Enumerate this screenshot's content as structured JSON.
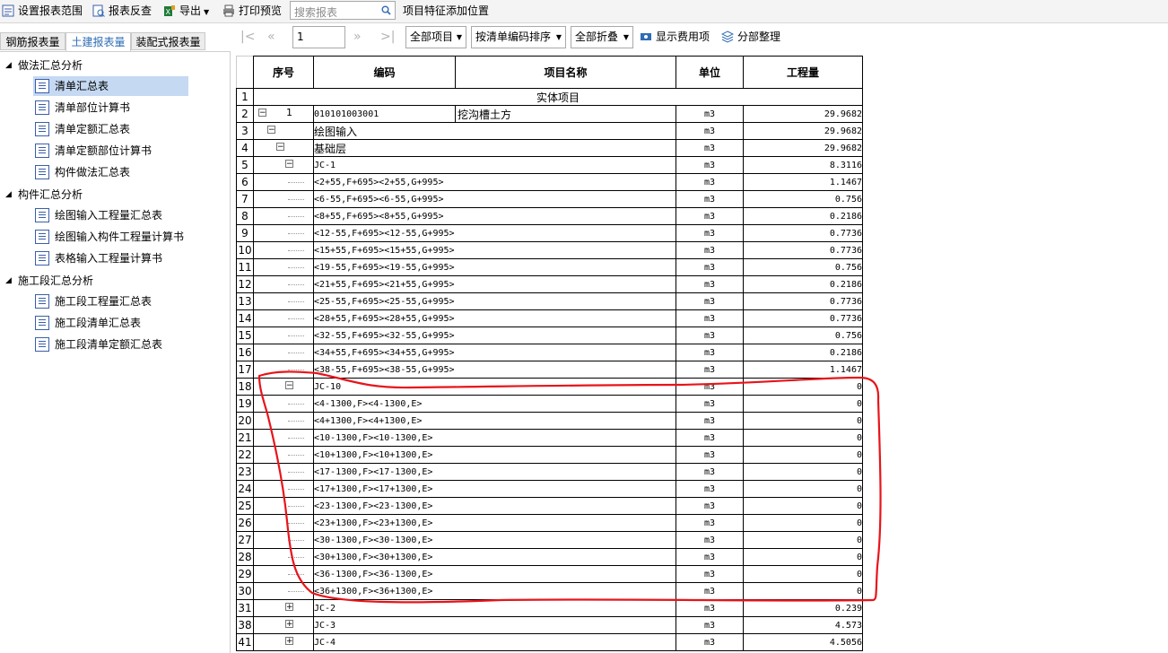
{
  "toolbar": {
    "items": [
      {
        "label": "设置报表范围",
        "icon": "report-range-icon"
      },
      {
        "label": "报表反查",
        "icon": "report-lookup-icon"
      },
      {
        "label": "导出",
        "icon": "export-icon"
      },
      {
        "label": "打印预览",
        "icon": "print-preview-icon"
      }
    ],
    "search_placeholder": "搜索报表",
    "feature_position": "项目特征添加位置"
  },
  "tabs": [
    {
      "label": "钢筋报表量",
      "active": false
    },
    {
      "label": "土建报表量",
      "active": true
    },
    {
      "label": "装配式报表量",
      "active": false
    }
  ],
  "tree": [
    {
      "group": "做法汇总分析",
      "items": [
        "清单汇总表",
        "清单部位计算书",
        "清单定额汇总表",
        "清单定额部位计算书",
        "构件做法汇总表"
      ]
    },
    {
      "group": "构件汇总分析",
      "items": [
        "绘图输入工程量汇总表",
        "绘图输入构件工程量计算书",
        "表格输入工程量计算书"
      ]
    },
    {
      "group": "施工段汇总分析",
      "items": [
        "施工段工程量汇总表",
        "施工段清单汇总表",
        "施工段清单定额汇总表"
      ]
    }
  ],
  "selected_item": "清单汇总表",
  "pager": {
    "page": "1"
  },
  "filters": {
    "scope": "全部项目",
    "sort": "按清单编码排序",
    "fold": "全部折叠",
    "show_cost": "显示费用项",
    "reorganize": "分部整理"
  },
  "table": {
    "headers": [
      "序号",
      "编码",
      "项目名称",
      "单位",
      "工程量"
    ],
    "section_title": "实体项目",
    "rows": [
      {
        "n": "1",
        "seq": "",
        "code": "",
        "name": "",
        "unit": "",
        "qty": ""
      },
      {
        "n": "2",
        "seq": "1",
        "code": "010101003001",
        "name": "挖沟槽土方",
        "unit": "m3",
        "qty": "29.9682"
      },
      {
        "n": "3",
        "seq": "",
        "code": "绘图输入",
        "name": "",
        "unit": "m3",
        "qty": "29.9682"
      },
      {
        "n": "4",
        "seq": "",
        "code": "基础层",
        "name": "",
        "unit": "m3",
        "qty": "29.9682"
      },
      {
        "n": "5",
        "seq": "",
        "code": "JC-1",
        "name": "",
        "unit": "m3",
        "qty": "8.3116"
      },
      {
        "n": "6",
        "seq": "",
        "code": "<2+55,F+695><2+55,G+995>",
        "name": "",
        "unit": "m3",
        "qty": "1.1467"
      },
      {
        "n": "7",
        "seq": "",
        "code": "<6-55,F+695><6-55,G+995>",
        "name": "",
        "unit": "m3",
        "qty": "0.756"
      },
      {
        "n": "8",
        "seq": "",
        "code": "<8+55,F+695><8+55,G+995>",
        "name": "",
        "unit": "m3",
        "qty": "0.2186"
      },
      {
        "n": "9",
        "seq": "",
        "code": "<12-55,F+695><12-55,G+995>",
        "name": "",
        "unit": "m3",
        "qty": "0.7736"
      },
      {
        "n": "10",
        "seq": "",
        "code": "<15+55,F+695><15+55,G+995>",
        "name": "",
        "unit": "m3",
        "qty": "0.7736"
      },
      {
        "n": "11",
        "seq": "",
        "code": "<19-55,F+695><19-55,G+995>",
        "name": "",
        "unit": "m3",
        "qty": "0.756"
      },
      {
        "n": "12",
        "seq": "",
        "code": "<21+55,F+695><21+55,G+995>",
        "name": "",
        "unit": "m3",
        "qty": "0.2186"
      },
      {
        "n": "13",
        "seq": "",
        "code": "<25-55,F+695><25-55,G+995>",
        "name": "",
        "unit": "m3",
        "qty": "0.7736"
      },
      {
        "n": "14",
        "seq": "",
        "code": "<28+55,F+695><28+55,G+995>",
        "name": "",
        "unit": "m3",
        "qty": "0.7736"
      },
      {
        "n": "15",
        "seq": "",
        "code": "<32-55,F+695><32-55,G+995>",
        "name": "",
        "unit": "m3",
        "qty": "0.756"
      },
      {
        "n": "16",
        "seq": "",
        "code": "<34+55,F+695><34+55,G+995>",
        "name": "",
        "unit": "m3",
        "qty": "0.2186"
      },
      {
        "n": "17",
        "seq": "",
        "code": "<38-55,F+695><38-55,G+995>",
        "name": "",
        "unit": "m3",
        "qty": "1.1467"
      },
      {
        "n": "18",
        "seq": "",
        "code": "JC-10",
        "name": "",
        "unit": "m3",
        "qty": "0"
      },
      {
        "n": "19",
        "seq": "",
        "code": "<4-1300,F><4-1300,E>",
        "name": "",
        "unit": "m3",
        "qty": "0"
      },
      {
        "n": "20",
        "seq": "",
        "code": "<4+1300,F><4+1300,E>",
        "name": "",
        "unit": "m3",
        "qty": "0"
      },
      {
        "n": "21",
        "seq": "",
        "code": "<10-1300,F><10-1300,E>",
        "name": "",
        "unit": "m3",
        "qty": "0"
      },
      {
        "n": "22",
        "seq": "",
        "code": "<10+1300,F><10+1300,E>",
        "name": "",
        "unit": "m3",
        "qty": "0"
      },
      {
        "n": "23",
        "seq": "",
        "code": "<17-1300,F><17-1300,E>",
        "name": "",
        "unit": "m3",
        "qty": "0"
      },
      {
        "n": "24",
        "seq": "",
        "code": "<17+1300,F><17+1300,E>",
        "name": "",
        "unit": "m3",
        "qty": "0"
      },
      {
        "n": "25",
        "seq": "",
        "code": "<23-1300,F><23-1300,E>",
        "name": "",
        "unit": "m3",
        "qty": "0"
      },
      {
        "n": "26",
        "seq": "",
        "code": "<23+1300,F><23+1300,E>",
        "name": "",
        "unit": "m3",
        "qty": "0"
      },
      {
        "n": "27",
        "seq": "",
        "code": "<30-1300,F><30-1300,E>",
        "name": "",
        "unit": "m3",
        "qty": "0"
      },
      {
        "n": "28",
        "seq": "",
        "code": "<30+1300,F><30+1300,E>",
        "name": "",
        "unit": "m3",
        "qty": "0"
      },
      {
        "n": "29",
        "seq": "",
        "code": "<36-1300,F><36-1300,E>",
        "name": "",
        "unit": "m3",
        "qty": "0"
      },
      {
        "n": "30",
        "seq": "",
        "code": "<36+1300,F><36+1300,E>",
        "name": "",
        "unit": "m3",
        "qty": "0"
      },
      {
        "n": "31",
        "seq": "",
        "code": "JC-2",
        "name": "",
        "unit": "m3",
        "qty": "0.239"
      },
      {
        "n": "38",
        "seq": "",
        "code": "JC-3",
        "name": "",
        "unit": "m3",
        "qty": "4.573"
      },
      {
        "n": "41",
        "seq": "",
        "code": "JC-4",
        "name": "",
        "unit": "m3",
        "qty": "4.5056"
      }
    ]
  },
  "colors": {
    "accent": "#2f6db5",
    "selection": "#c5d9f2",
    "annotation": "#e8141a"
  }
}
